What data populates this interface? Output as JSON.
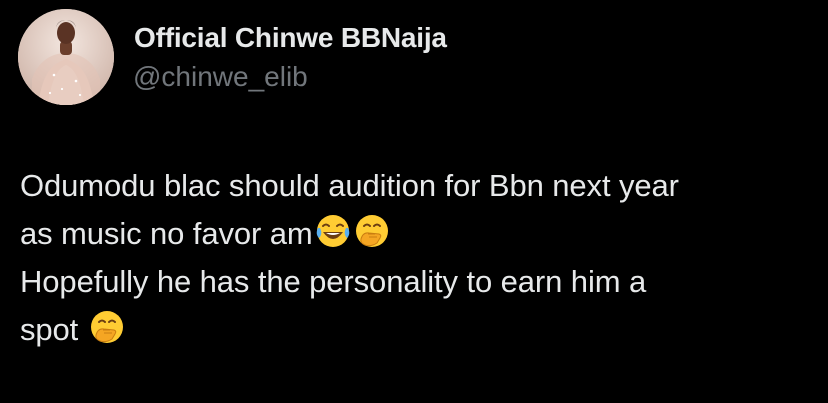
{
  "author": {
    "display_name": "Official Chinwe BBNaija",
    "handle": "@chinwe_elib",
    "avatar_icon": "profile-photo"
  },
  "tweet": {
    "line1": "Odumodu blac should audition for Bbn next year",
    "line2": "as music no favor am",
    "line2_emojis": [
      "face-with-tears-of-joy-icon",
      "face-with-hand-over-mouth-icon"
    ],
    "line3": "Hopefully he has the personality to earn him a",
    "line4": "spot",
    "line4_emojis": [
      "face-with-hand-over-mouth-icon"
    ]
  },
  "colors": {
    "background": "#000000",
    "text_primary": "#e7e9ea",
    "text_secondary": "#71767b",
    "emoji_yellow": "#ffcc33"
  }
}
